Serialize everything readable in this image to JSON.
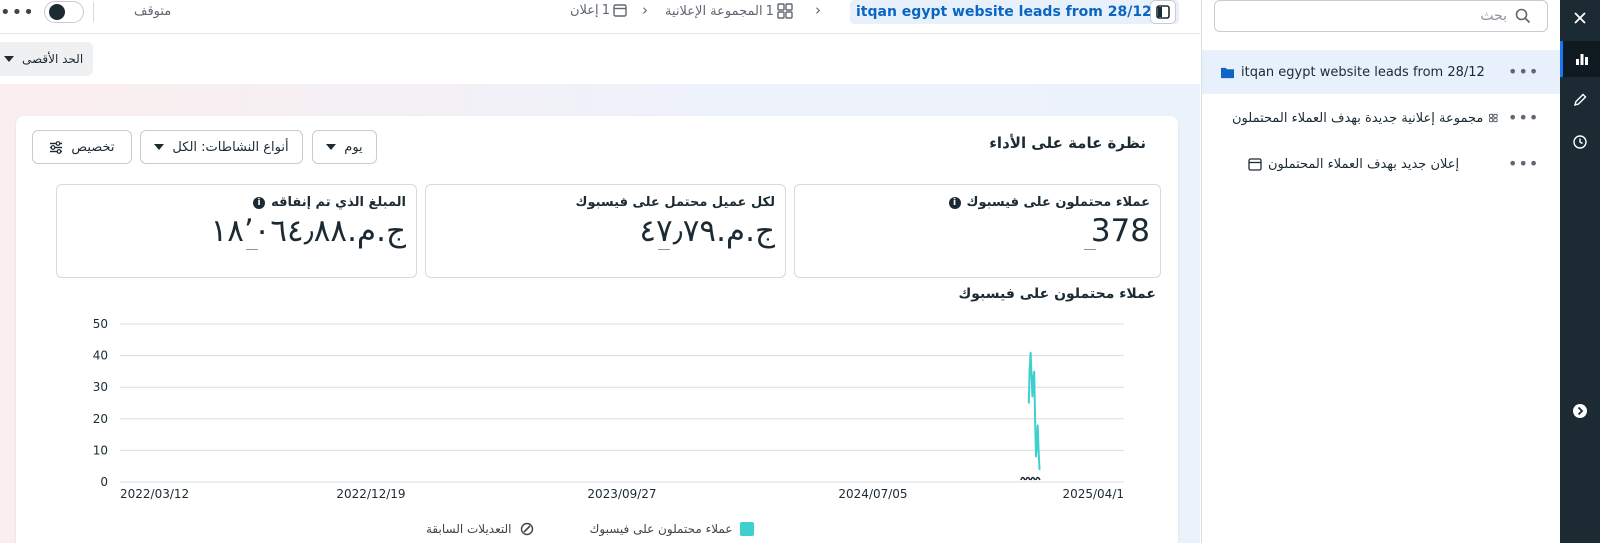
{
  "topbar": {
    "more": "•••",
    "status_label": "متوقف",
    "breadcrumb": {
      "ads": {
        "count": "1",
        "label": "إعلان"
      },
      "adsets": {
        "count": "1",
        "label": "المجموعة الإعلانية"
      },
      "campaign": "itqan egypt website leads from 28/12"
    }
  },
  "max_button": {
    "label": "الحد الأقصى"
  },
  "overview": {
    "title": "نظرة عامة على الأداء",
    "day_select": "يوم",
    "activity_types": "أنواع النشاطات: الكل",
    "customize": "تخصيص"
  },
  "metrics": [
    {
      "label": "عملاء محتملون على فيسبوك",
      "value": "378",
      "info": "i"
    },
    {
      "label": "لكل عميل محتمل على فيسبوك",
      "value": "ج.م.٤٧٫٧٩"
    },
    {
      "label": "المبلغ الذي تم إنفاقه",
      "value": "ج.م.١٨٬٠٦٤٫٨٨",
      "info": "i"
    }
  ],
  "chart_title": "عملاء محتملون على فيسبوك",
  "chart_data": {
    "type": "line",
    "title": "عملاء محتملون على فيسبوك",
    "xlabel": "",
    "ylabel": "",
    "ylim": [
      0,
      50
    ],
    "yticks": [
      "0",
      "10",
      "20",
      "30",
      "40",
      "50"
    ],
    "xticks": [
      "2022/03/12",
      "2022/12/19",
      "2023/09/27",
      "2024/07/05",
      "2025/04/1"
    ],
    "xlim": [
      "2022/03/12",
      "2025/04/14"
    ],
    "series": [
      {
        "color": "#3ecfcf",
        "points": [
          {
            "x": "2024/12/28",
            "y": 25
          },
          {
            "x": "2024/12/29",
            "y": 36
          },
          {
            "x": "2024/12/30",
            "y": 41
          },
          {
            "x": "2024/12/31",
            "y": 34
          },
          {
            "x": "2025/01/01",
            "y": 27
          },
          {
            "x": "2025/01/02",
            "y": 33
          },
          {
            "x": "2025/01/03",
            "y": 35
          },
          {
            "x": "2025/01/04",
            "y": 20
          },
          {
            "x": "2025/01/05",
            "y": 8
          },
          {
            "x": "2025/01/06",
            "y": 12
          },
          {
            "x": "2025/01/07",
            "y": 18
          },
          {
            "x": "2025/01/08",
            "y": 10
          },
          {
            "x": "2025/01/09",
            "y": 4
          }
        ]
      }
    ],
    "grid": true
  },
  "legend": {
    "series_label": "عملاء محتملون على فيسبوك",
    "edits_label": "التعديلات السابقة"
  },
  "sidebar": {
    "search_placeholder": "بحث",
    "tree": [
      {
        "label": "itqan egypt website leads from 28/12",
        "icon": "folder-icon"
      },
      {
        "label": "مجموعة إعلانية جديدة بهدف العملاء المحتملون",
        "icon": "grid-icon"
      },
      {
        "label": "إعلان جديد بهدف العملاء المحتملون",
        "icon": "ad-icon"
      }
    ]
  },
  "colors": {
    "accent": "#0a66c2",
    "series": "#3ecfcf",
    "rail": "#1c2b33"
  }
}
